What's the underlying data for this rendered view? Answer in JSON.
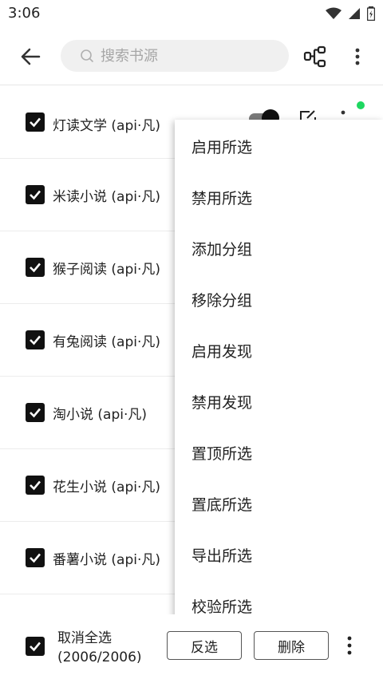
{
  "status": {
    "time": "3:06"
  },
  "search": {
    "placeholder": "搜索书源"
  },
  "list": {
    "items": [
      {
        "label": "灯读文学 (api·凡)"
      },
      {
        "label": "米读小说 (api·凡)"
      },
      {
        "label": "猴子阅读 (api·凡)"
      },
      {
        "label": "有兔阅读 (api·凡)"
      },
      {
        "label": "淘小说 (api·凡)"
      },
      {
        "label": "花生小说 (api·凡)"
      },
      {
        "label": "番薯小说 (api·凡)"
      }
    ]
  },
  "menu": {
    "items": [
      {
        "label": "启用所选"
      },
      {
        "label": "禁用所选"
      },
      {
        "label": "添加分组"
      },
      {
        "label": "移除分组"
      },
      {
        "label": "启用发现"
      },
      {
        "label": "禁用发现"
      },
      {
        "label": "置顶所选"
      },
      {
        "label": "置底所选"
      },
      {
        "label": "导出所选"
      },
      {
        "label": "校验所选"
      }
    ]
  },
  "bottom": {
    "select_label_line1": "取消全选",
    "select_label_line2": "(2006/2006)",
    "invert_label": "反选",
    "delete_label": "删除"
  }
}
